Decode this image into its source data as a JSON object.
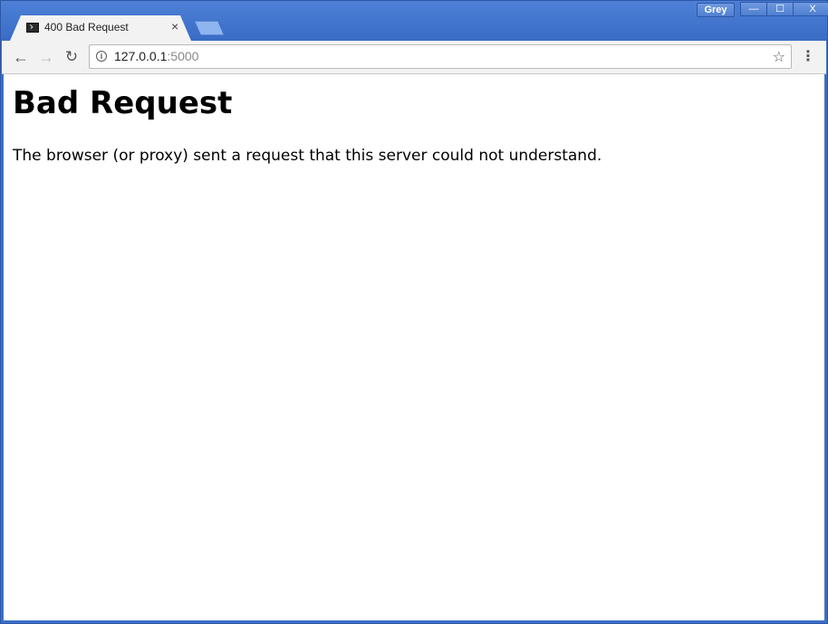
{
  "window": {
    "profile_name": "Grey",
    "controls": {
      "minimize": "—",
      "maximize": "☐",
      "close": "X"
    }
  },
  "tab": {
    "title": "400 Bad Request",
    "close": "×",
    "favicon": "terminal-icon"
  },
  "toolbar": {
    "back": "←",
    "forward": "→",
    "reload": "↻",
    "info": "i",
    "url_host": "127.0.0.1",
    "url_port": ":5000",
    "bookmark": "☆",
    "menu": "⋮"
  },
  "page": {
    "heading": "Bad Request",
    "message": "The browser (or proxy) sent a request that this server could not understand."
  },
  "colors": {
    "frame": "#3d6fc7",
    "tab_bg": "#f2f2f2",
    "content_bg": "#ffffff"
  }
}
